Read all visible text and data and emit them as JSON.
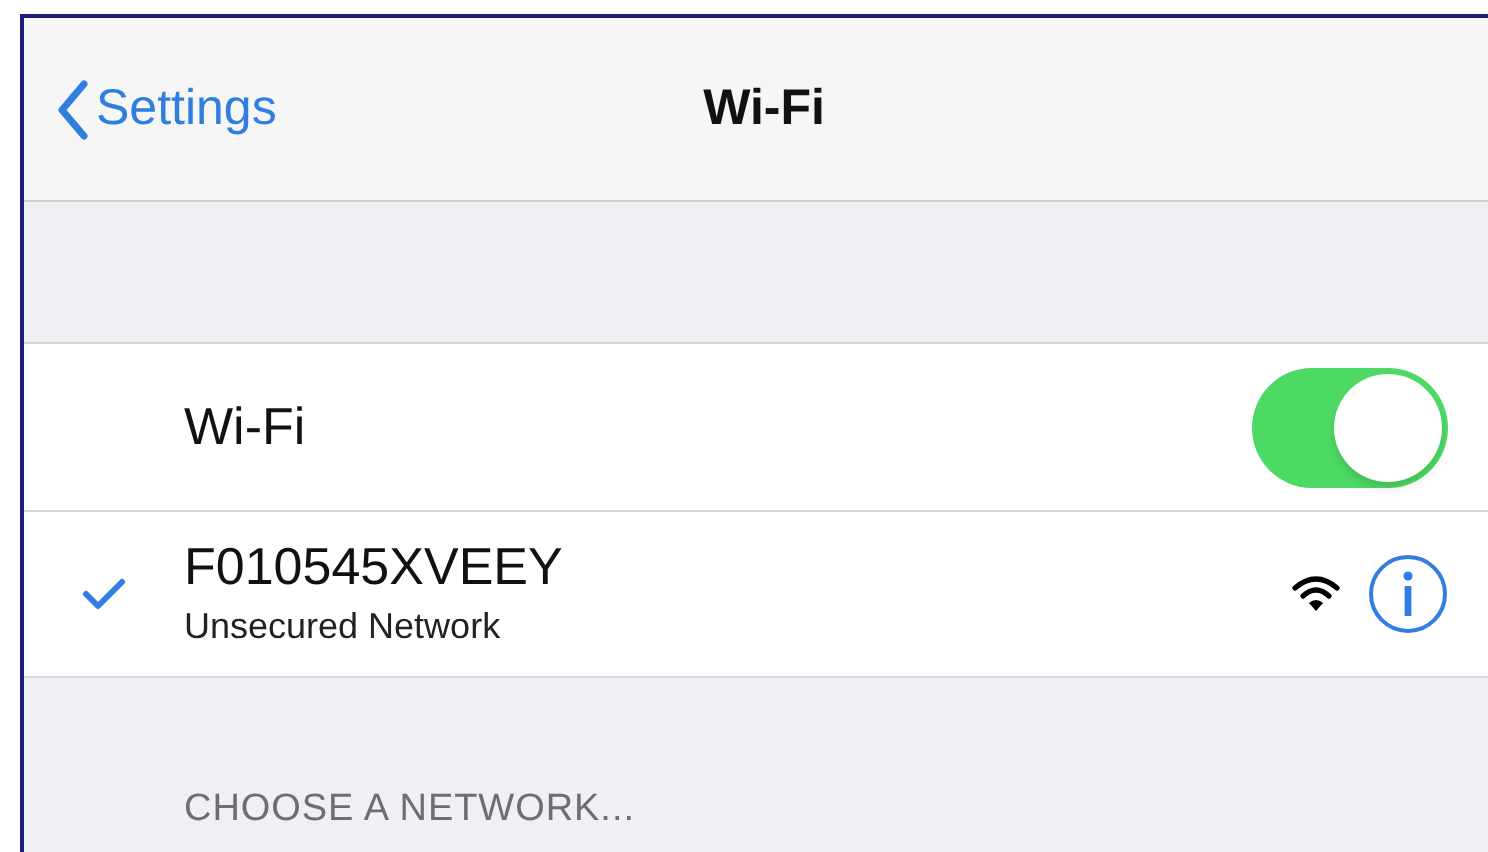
{
  "nav": {
    "back": "Settings",
    "title": "Wi-Fi"
  },
  "wifi_row": {
    "label": "Wi-Fi",
    "on": true
  },
  "networks": [
    {
      "name": "F010545XVEEY",
      "subtitle": "Unsecured Network",
      "selected": true
    }
  ],
  "section_header": "CHOOSE A NETWORK..."
}
